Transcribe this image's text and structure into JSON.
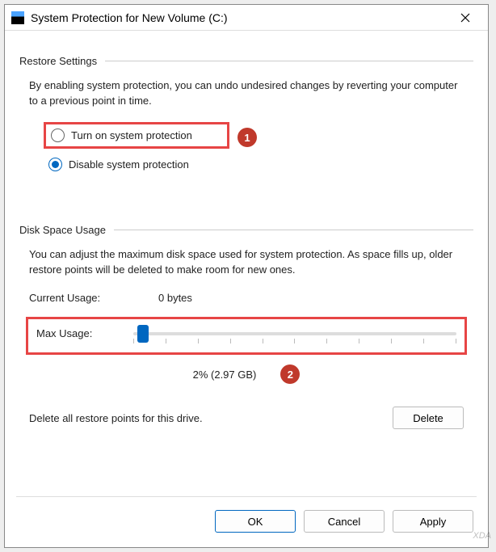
{
  "window": {
    "title": "System Protection for New Volume (C:)"
  },
  "sections": {
    "restore": {
      "header": "Restore Settings",
      "description": "By enabling system protection, you can undo undesired changes by reverting your computer to a previous point in time.",
      "options": {
        "turn_on": "Turn on system protection",
        "disable": "Disable system protection",
        "selected": "disable"
      }
    },
    "disk": {
      "header": "Disk Space Usage",
      "description": "You can adjust the maximum disk space used for system protection. As space fills up, older restore points will be deleted to make room for new ones.",
      "current_usage_label": "Current Usage:",
      "current_usage_value": "0 bytes",
      "max_usage_label": "Max Usage:",
      "max_usage_value": "2% (2.97 GB)",
      "slider_percent": 2
    },
    "delete": {
      "text": "Delete all restore points for this drive.",
      "button": "Delete"
    }
  },
  "markers": {
    "one": "1",
    "two": "2"
  },
  "buttons": {
    "ok": "OK",
    "cancel": "Cancel",
    "apply": "Apply"
  },
  "watermark": "XDA"
}
